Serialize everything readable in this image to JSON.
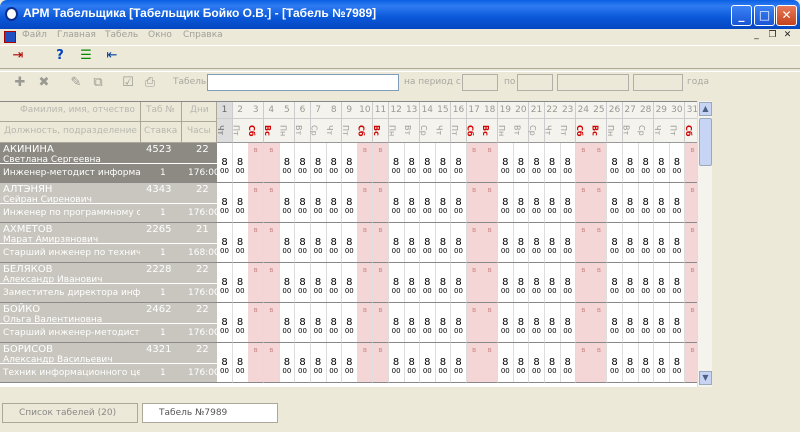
{
  "window": {
    "title": "АРМ Табельщика [Табельщик Бойко О.В.] - [Табель №7989]"
  },
  "menu": [
    "Файл",
    "Главная",
    "Табель",
    "Окно",
    "Справка"
  ],
  "toolbar2": {
    "tabel_label": "Табель",
    "period_label": "на период с",
    "to_label": "по",
    "year_label": "года"
  },
  "grid_header": {
    "name_title": "Фамилия, имя, отчество",
    "pos_title": "Должность, подразделение",
    "tab_title": "Таб №",
    "rate_title": "Ставка",
    "days_title": "Дни",
    "hours_title": "Часы"
  },
  "days": [
    "1",
    "2",
    "3",
    "4",
    "5",
    "6",
    "7",
    "8",
    "9",
    "10",
    "11",
    "12",
    "13",
    "14",
    "15",
    "16",
    "17",
    "18",
    "19",
    "20",
    "21",
    "22",
    "23",
    "24",
    "25",
    "26",
    "27",
    "28",
    "29",
    "30",
    "31"
  ],
  "weekdays": [
    "Чт",
    "Пт",
    "Сб",
    "Вс",
    "Пн",
    "Вт",
    "Ср",
    "Чт",
    "Пт",
    "Сб",
    "Вс",
    "Пн",
    "Вт",
    "Ср",
    "Чт",
    "Пт",
    "Сб",
    "Вс",
    "Пн",
    "Вт",
    "Ср",
    "Чт",
    "Пт",
    "Сб",
    "Вс",
    "Пн",
    "Вт",
    "Ср",
    "Чт",
    "Пт",
    "Сб"
  ],
  "employees": [
    {
      "surname": "АКИНИНА",
      "first": "Светлана Сергеевна",
      "position": "Инженер-методист информационно",
      "tab": "4523",
      "rate": "1",
      "days": "22",
      "hours": "176:00"
    },
    {
      "surname": "АЛТЭНЯН",
      "first": "Сейран Сиренович",
      "position": "Инженер по программному обеспечению",
      "tab": "4343",
      "rate": "1",
      "days": "22",
      "hours": "176:00"
    },
    {
      "surname": "АХМЕТОВ",
      "first": "Марат Амирзянович",
      "position": "Старший инженер по техническому",
      "tab": "2265",
      "rate": "1",
      "days": "21",
      "hours": "168:00"
    },
    {
      "surname": "БЕЛЯКОВ",
      "first": "Александр Иванович",
      "position": "Заместитель директора информ.",
      "tab": "2228",
      "rate": "1",
      "days": "22",
      "hours": "176:00"
    },
    {
      "surname": "БОЙКО",
      "first": "Ольга Валентиновна",
      "position": "Старший инженер-методист",
      "tab": "2462",
      "rate": "1",
      "days": "22",
      "hours": "176:00"
    },
    {
      "surname": "БОРИСОВ",
      "first": "Александр Васильевич",
      "position": "Техник информационного центра",
      "tab": "4321",
      "rate": "1",
      "days": "22",
      "hours": "176:00"
    }
  ],
  "cell_value": "8",
  "cell_sub": "00",
  "weekend_mark": "в",
  "status_tabs": [
    "Список табелей (20)",
    "Табель №7989"
  ]
}
